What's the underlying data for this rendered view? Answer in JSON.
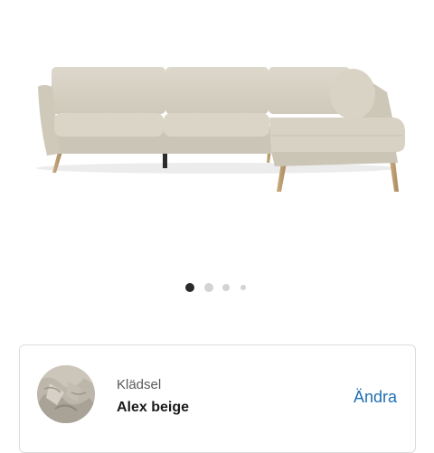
{
  "product": {
    "image_icon": "sofa-icon",
    "fabric_color": "#d8d2c4"
  },
  "carousel": {
    "total": 4,
    "active_index": 0,
    "active_color": "#2a2a2a",
    "inactive_color": "#d3d3d3"
  },
  "option": {
    "label": "Klädsel",
    "value": "Alex beige",
    "change_label": "Ändra",
    "link_color": "#1f6fb2"
  }
}
